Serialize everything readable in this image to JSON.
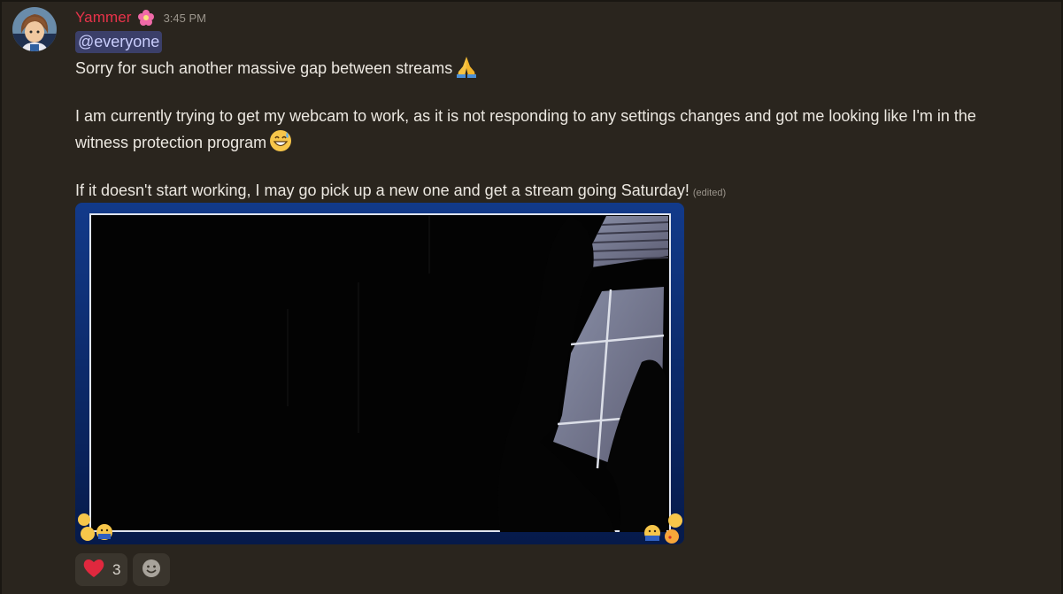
{
  "message": {
    "author": "Yammer",
    "timestamp": "3:45 PM",
    "mention": "@everyone",
    "lines": [
      "Sorry for such another massive gap between streams",
      "I am currently trying to get my webcam to work, as it is not responding to any settings changes and got me looking like I'm in the",
      "witness protection program",
      "If it doesn't start working, I may go pick up a new one and get a stream going Saturday!"
    ],
    "edited_label": "(edited)"
  },
  "reactions": [
    {
      "emoji": "heart",
      "count": "3"
    }
  ],
  "colors": {
    "username": "#e8334a",
    "mention_bg": "#3b3f69",
    "mention_text": "#c9cdfb",
    "background": "#2a251e"
  },
  "icons": {
    "role": "flower-icon",
    "line1_emoji": "folded-hands-icon",
    "line3_emoji": "grinning-sweat-icon",
    "reaction": "heart-icon",
    "add_reaction": "add-reaction-icon"
  }
}
